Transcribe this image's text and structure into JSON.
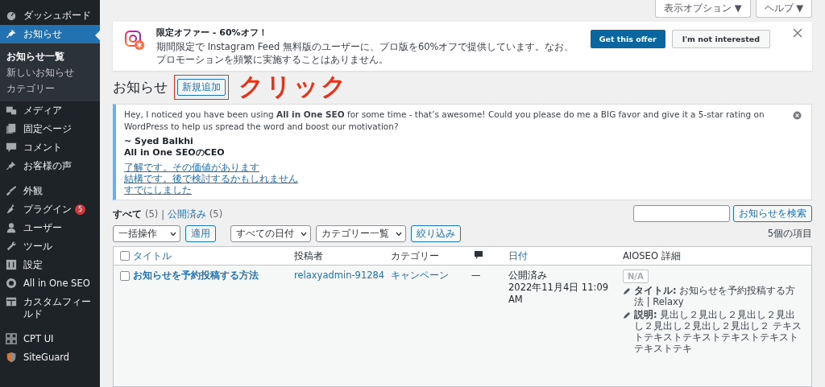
{
  "sidebar": {
    "sections": [
      {
        "items": [
          {
            "label": "ダッシュボード",
            "selected": false
          },
          {
            "label": "お知らせ",
            "selected": true,
            "children": [
              {
                "label": "お知らせ一覧",
                "selected": true
              },
              {
                "label": "新しいお知らせ",
                "selected": false
              },
              {
                "label": "カテゴリー",
                "selected": false
              }
            ]
          },
          {
            "label": "メディア",
            "selected": false
          },
          {
            "label": "固定ページ",
            "selected": false
          },
          {
            "label": "コメント",
            "selected": false
          },
          {
            "label": "お客様の声",
            "selected": false
          }
        ]
      },
      {
        "items": [
          {
            "label": "外観",
            "selected": false
          },
          {
            "label": "プラグイン",
            "selected": false,
            "badge": "5"
          },
          {
            "label": "ユーザー",
            "selected": false
          },
          {
            "label": "ツール",
            "selected": false
          },
          {
            "label": "設定",
            "selected": false
          },
          {
            "label": "All in One SEO",
            "selected": false
          },
          {
            "label": "カスタムフィールド",
            "selected": false
          }
        ]
      },
      {
        "items": [
          {
            "label": "CPT UI",
            "selected": false
          },
          {
            "label": "SiteGuard",
            "selected": false
          }
        ]
      }
    ]
  },
  "screen_meta": [
    "表示オプション ▼",
    "ヘルプ ▼"
  ],
  "promo": {
    "title": "限定オファー - 60%オフ！",
    "body": "期間限定で Instagram Feed 無料版のユーザーに、プロ版を60%オフで提供しています。なお、プロモーションを頻繁に実施することはありません。",
    "primary_button": "Get this offer",
    "secondary_button": "I'm not interested"
  },
  "heading": {
    "title": "お知らせ",
    "add_button": "新規追加",
    "highlighted": true,
    "annotation": "クリック"
  },
  "review_notice": {
    "message": "Hey, I noticed you have been using **All in One SEO** for some time - that’s awesome! Could you please do me a BIG favor and give it a 5-star rating on WordPress to help us spread the word and boost our motivation?",
    "signature": [
      "~ Syed Balkhi",
      "All in One SEOのCEO"
    ],
    "links": [
      "了解です。その価値があります",
      "結構です。後で検討するかもしれません",
      "すでにしました"
    ]
  },
  "status_separator": "|",
  "status_links": [
    {
      "label": "すべて",
      "count": "(5)",
      "selected": true
    },
    {
      "label": "公開済み",
      "count": "(5)",
      "selected": false
    }
  ],
  "search_button": "お知らせを検索",
  "filters": {
    "bulk_action": "一括操作",
    "apply": "適用",
    "date": "すべての日付",
    "category": "カテゴリー一覧",
    "filter_button": "絞り込み",
    "item_count": "5個の項目"
  },
  "table": {
    "select_all_checked": false,
    "columns": [
      {
        "label": "タイトル",
        "kind": "link"
      },
      {
        "label": "投稿者",
        "kind": "text"
      },
      {
        "label": "カテゴリー",
        "kind": "text"
      },
      {
        "kind": "comments"
      },
      {
        "label": "日付",
        "kind": "link"
      },
      {
        "label": "AIOSEO 詳細",
        "kind": "text"
      }
    ],
    "rows": [
      {
        "checked": false,
        "title": "お知らせを予約投稿する方法",
        "author": "relaxyadmin-91284",
        "category": "キャンペーン",
        "comments": "—",
        "status": "公開済み",
        "date": "2022年11月4日 11:09 AM",
        "score": "N/A",
        "seo_title": "**タイトル:** お知らせを予約投稿する方法 | Relaxy",
        "seo_description": "**説明:** 見出し２見出し２見出し２見出し２見出し２見出し２見出し２ テキストテキストテキストテキストテキストテキストテキ"
      }
    ]
  }
}
